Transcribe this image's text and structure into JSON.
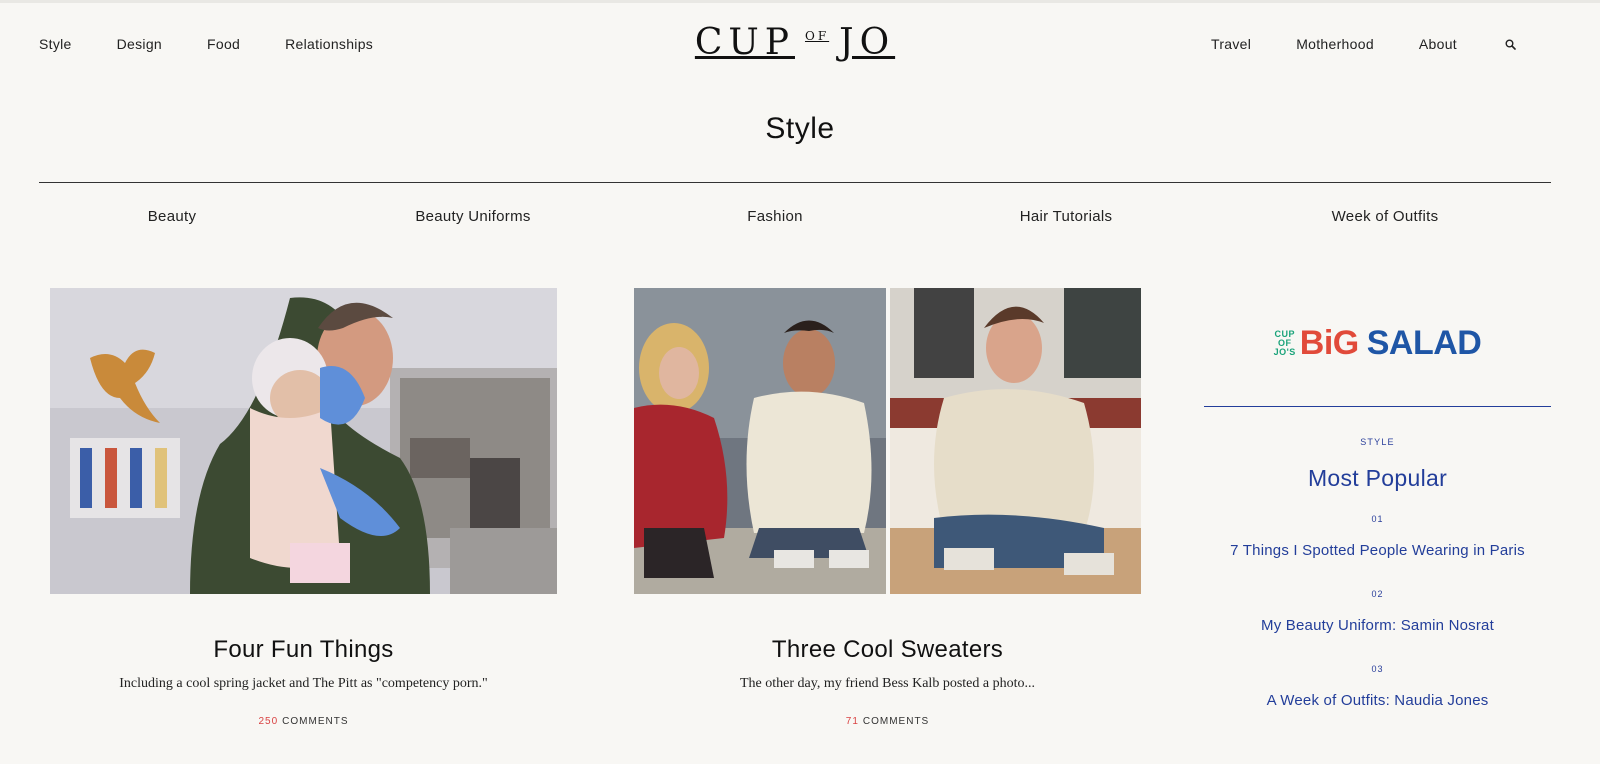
{
  "header": {
    "nav_left": [
      "Style",
      "Design",
      "Food",
      "Relationships"
    ],
    "logo": {
      "cup": "CUP",
      "of": "OF",
      "jo": "JO"
    },
    "nav_right": [
      "Travel",
      "Motherhood",
      "About"
    ],
    "search_icon": "search-icon"
  },
  "page": {
    "title": "Style"
  },
  "subnav": [
    "Beauty",
    "Beauty Uniforms",
    "Fashion",
    "Hair Tutorials",
    "Week of Outfits"
  ],
  "cards": [
    {
      "title": "Four Fun Things",
      "dek": "Including a cool spring jacket and The Pitt as \"competency porn.\"",
      "comment_count": "250",
      "comment_label": "COMMENTS"
    },
    {
      "title": "Three Cool Sweaters",
      "dek": "The other day, my friend Bess Kalb posted a photo...",
      "comment_count": "71",
      "comment_label": "COMMENTS"
    }
  ],
  "sidebar": {
    "big_salad": {
      "small_lines": [
        "CUP",
        "OF",
        "JO'S"
      ],
      "big": "BiG",
      "salad": "SALAD"
    },
    "kicker": "STYLE",
    "heading": "Most Popular",
    "items": [
      {
        "num": "01",
        "title": "7 Things I Spotted People Wearing in Paris"
      },
      {
        "num": "02",
        "title": "My Beauty Uniform: Samin Nosrat"
      },
      {
        "num": "03",
        "title": "A Week of Outfits: Naudia Jones"
      }
    ]
  },
  "colors": {
    "background": "#f8f7f4",
    "accent_blue": "#233e9a",
    "comment_red": "#d94343",
    "big_salad_red": "#e14a3a",
    "big_salad_blue": "#1f56a6",
    "big_salad_green": "#1aa37a"
  }
}
